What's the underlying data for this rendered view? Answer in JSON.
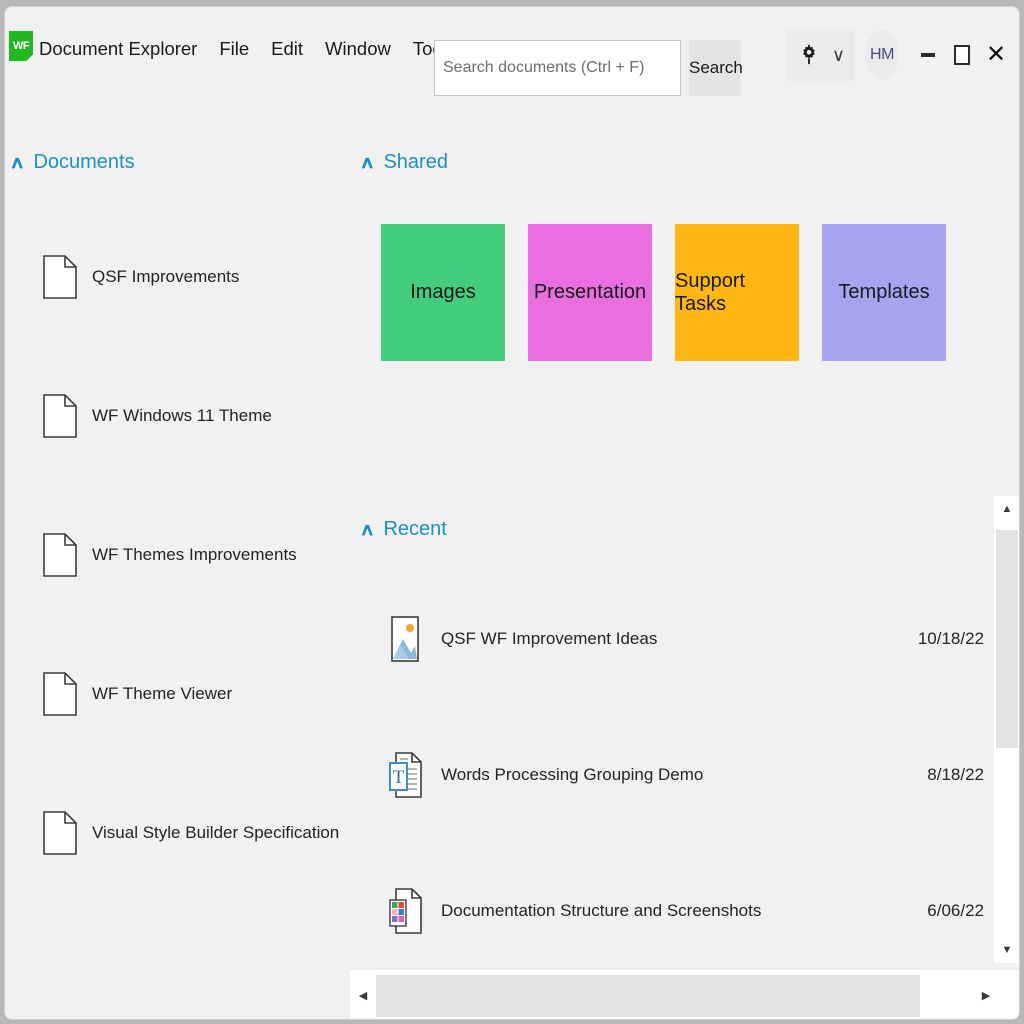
{
  "window": {
    "app_logo_text": "WF",
    "app_name": "Document Explorer",
    "menu_items": [
      "File",
      "Edit",
      "Window",
      "Tools"
    ],
    "minimize_label": "Minimize",
    "maximize_label": "Maximize",
    "close_label": "Close"
  },
  "search": {
    "placeholder": "Search documents (Ctrl + F)",
    "value": "",
    "button_label": "Search"
  },
  "account": {
    "avatar_initials": "HM",
    "settings_icon": "gear-icon",
    "dropdown_icon": "chevron-down-icon",
    "dropdown_glyph": "∨"
  },
  "sidebar": {
    "section_title": "Documents",
    "collapse_glyph": "∧",
    "items": [
      {
        "label": "QSF Improvements",
        "icon": "document-icon"
      },
      {
        "label": "WF Windows 11 Theme",
        "icon": "document-icon"
      },
      {
        "label": "WF Themes Improvements",
        "icon": "document-icon"
      },
      {
        "label": "WF Theme Viewer",
        "icon": "document-icon"
      },
      {
        "label": "Visual Style Builder Specification",
        "icon": "document-icon"
      }
    ]
  },
  "shared": {
    "section_title": "Shared",
    "collapse_glyph": "∧",
    "tiles": [
      {
        "label": "Images",
        "color": "#44cc7d"
      },
      {
        "label": "Presentation",
        "color": "#e96fe0"
      },
      {
        "label": "Support Tasks",
        "color": "#ffb813"
      },
      {
        "label": "Templates",
        "color": "#a6a3f0"
      }
    ]
  },
  "recent": {
    "section_title": "Recent",
    "collapse_glyph": "∧",
    "items": [
      {
        "label": "QSF WF Improvement Ideas",
        "date": "10/18/22",
        "icon": "image-file-icon"
      },
      {
        "label": "Words Processing Grouping Demo",
        "date": "8/18/22",
        "icon": "text-document-icon"
      },
      {
        "label": "Documentation Structure and Screenshots",
        "date": "6/06/22",
        "icon": "palette-document-icon"
      }
    ]
  },
  "scrollbars": {
    "up_glyph": "▲",
    "down_glyph": "▼",
    "left_glyph": "◀",
    "right_glyph": "▶"
  },
  "colors": {
    "accent": "#1e8fc4",
    "logo_green": "#22b81f",
    "window_bg": "#f1f1f1"
  }
}
